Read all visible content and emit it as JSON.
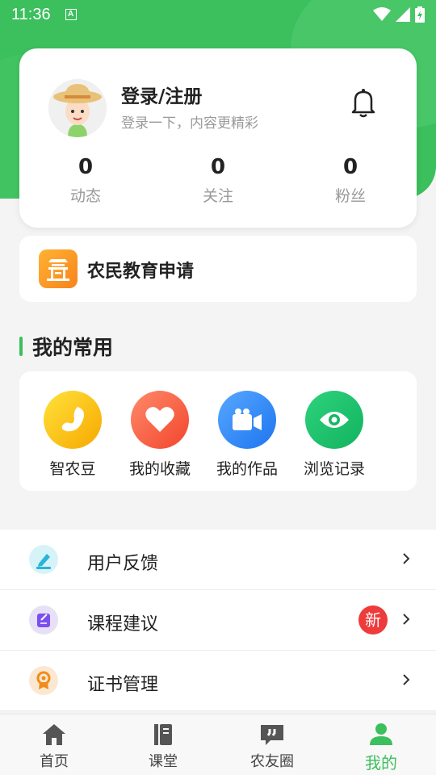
{
  "status_bar": {
    "time": "11:36",
    "notif_letter": "A"
  },
  "profile": {
    "title": "登录/注册",
    "subtitle": "登录一下，内容更精彩",
    "stats": [
      {
        "value": "0",
        "label": "动态"
      },
      {
        "value": "0",
        "label": "关注"
      },
      {
        "value": "0",
        "label": "粉丝"
      }
    ]
  },
  "edu": {
    "label": "农民教育申请"
  },
  "common": {
    "title": "我的常用",
    "items": [
      {
        "label": "智农豆",
        "icon": "bean-icon"
      },
      {
        "label": "我的收藏",
        "icon": "heart-icon"
      },
      {
        "label": "我的作品",
        "icon": "video-camera-icon"
      },
      {
        "label": "浏览记录",
        "icon": "eye-icon"
      }
    ]
  },
  "menu": [
    {
      "label": "用户反馈",
      "icon": "pen-icon"
    },
    {
      "label": "课程建议",
      "icon": "edit-note-icon",
      "badge": "新"
    },
    {
      "label": "证书管理",
      "icon": "certificate-icon"
    }
  ],
  "tabs": [
    {
      "label": "首页",
      "icon": "home-icon"
    },
    {
      "label": "课堂",
      "icon": "book-icon"
    },
    {
      "label": "农友圈",
      "icon": "chat-quote-icon"
    },
    {
      "label": "我的",
      "icon": "user-icon",
      "active": true
    }
  ],
  "colors": {
    "brand_green": "#3cbf5d",
    "badge_red": "#ee3b3b"
  }
}
